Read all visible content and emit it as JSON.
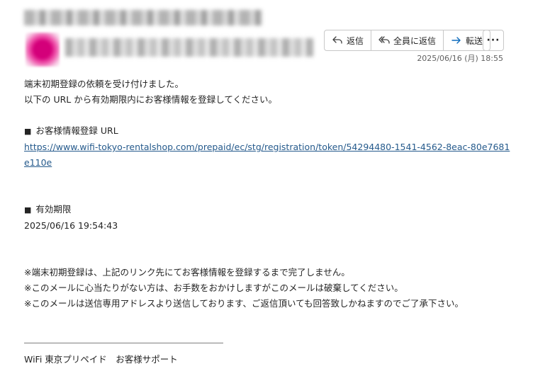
{
  "header": {
    "actions": [
      {
        "label": "返信",
        "icon": "reply-icon"
      },
      {
        "label": "全員に返信",
        "icon": "reply-all-icon"
      },
      {
        "label": "転送",
        "icon": "forward-icon"
      }
    ],
    "more_label": "···",
    "date": "2025/06/16 (月) 18:55"
  },
  "body": {
    "line1": "端末初期登録の依頼を受け付けました。",
    "line2": "以下の URL から有効期限内にお客様情報を登録してください。",
    "section1_title": "お客様情報登録 URL",
    "url": "https://www.wifi-tokyo-rentalshop.com/prepaid/ec/stg/registration/token/54294480-1541-4562-8eac-80e7681e110e",
    "section2_title": "有効期限",
    "expiry": "2025/06/16 19:54:43",
    "note1": "※端末初期登録は、上記のリンク先にてお客様情報を登録するまで完了しません。",
    "note2": "※このメールに心当たりがない方は、お手数をおかけしますがこのメールは破棄してください。",
    "note3": "※このメールは送信専用アドレスより送信しております、ご返信頂いても回答致しかねますのでご了承下さい。",
    "signature": "WiFi 東京プリペイド　お客様サポート",
    "bullet": "■"
  },
  "colors": {
    "link": "#255a8c",
    "avatar": "#d4007a",
    "forward_icon": "#0f6cbd"
  }
}
